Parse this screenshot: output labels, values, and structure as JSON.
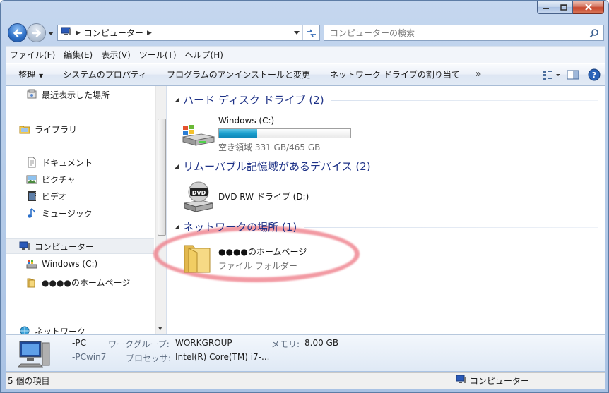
{
  "window": {
    "caption_buttons": [
      "minimize",
      "maximize",
      "close"
    ]
  },
  "address": {
    "breadcrumb": "コンピューター",
    "search_placeholder": "コンピューターの検索"
  },
  "menu": {
    "items": [
      "ファイル(F)",
      "編集(E)",
      "表示(V)",
      "ツール(T)",
      "ヘルプ(H)"
    ]
  },
  "commands": {
    "organize": "整理",
    "items": [
      "システムのプロパティ",
      "プログラムのアンインストールと変更",
      "ネットワーク ドライブの割り当て"
    ],
    "more": "»"
  },
  "nav": {
    "recent": "最近表示した場所",
    "libraries": "ライブラリ",
    "documents": "ドキュメント",
    "pictures": "ピクチャ",
    "videos": "ビデオ",
    "music": "ミュージック",
    "computer": "コンピューター",
    "windows_c": "Windows (C:)",
    "homepage": "●●●●のホームページ",
    "network": "ネットワーク"
  },
  "content": {
    "groups": [
      {
        "title": "ハード ディスク ドライブ (2)"
      },
      {
        "title": "リムーバブル記憶域があるデバイス (2)"
      },
      {
        "title": "ネットワークの場所 (1)"
      }
    ],
    "drive_c": {
      "name": "Windows (C:)",
      "free_text": "空き領域 331 GB/465 GB",
      "used_fraction": 0.288
    },
    "dvd": {
      "name": "DVD RW ドライブ (D:)",
      "badge": "DVD"
    },
    "netfolder": {
      "name": "●●●●のホームページ",
      "type": "ファイル フォルダー"
    }
  },
  "details": {
    "pc_name": "-PC",
    "pc_sub": "-PCwin7",
    "workgroup_label": "ワークグループ:",
    "workgroup_value": "WORKGROUP",
    "memory_label": "メモリ:",
    "memory_value": "8.00 GB",
    "processor_label": "プロセッサ:",
    "processor_value": "Intel(R) Core(TM) i7-..."
  },
  "status": {
    "item_count": "5 個の項目",
    "location": "コンピューター"
  },
  "colors": {
    "group_title": "#1e3287",
    "highlight_ring": "#ee7884",
    "progress": "#1b9fcd"
  }
}
